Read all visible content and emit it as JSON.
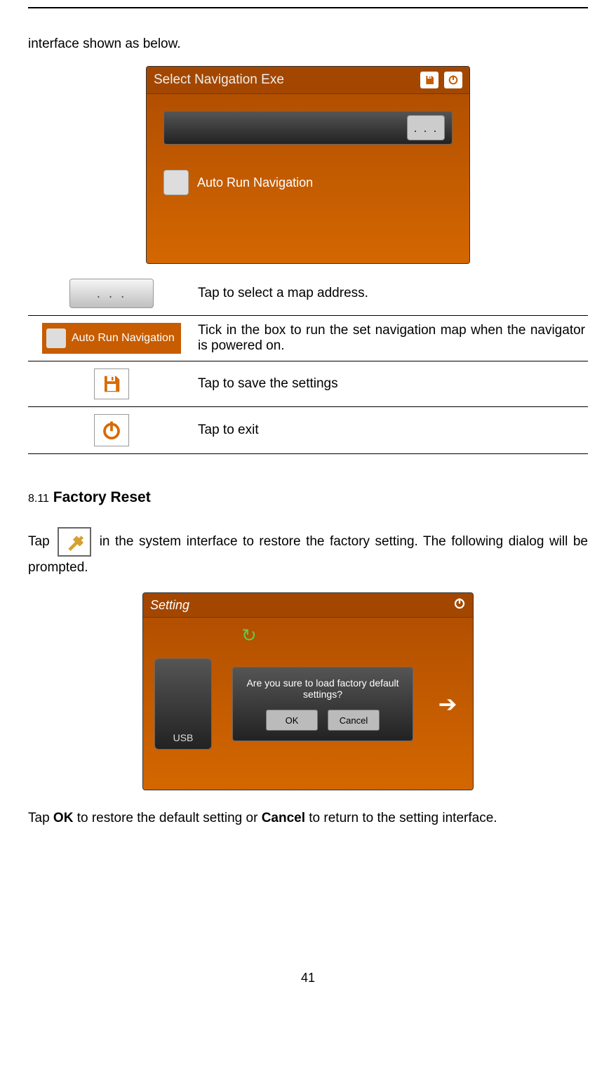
{
  "intro": "interface shown as below.",
  "screenshot1": {
    "title": "Select Navigation Exe",
    "path_btn": ". . .",
    "checkbox_label": "Auto Run Navigation"
  },
  "legend": [
    {
      "icon": "dots",
      "dots_label": ". . .",
      "desc": "Tap to select a map address."
    },
    {
      "icon": "autorun",
      "autorun_label": "Auto Run Navigation",
      "desc": "Tick in the box to run the set navigation map when the navigator is powered on."
    },
    {
      "icon": "save",
      "desc": "Tap to save the settings"
    },
    {
      "icon": "power",
      "desc": "Tap to exit"
    }
  ],
  "section": {
    "num": "8.11",
    "title": "Factory Reset"
  },
  "paragraph1_a": "Tap ",
  "paragraph1_b": " in the system interface to restore the factory setting. The following dialog will be prompted.",
  "screenshot2": {
    "title": "Setting",
    "usb_label": "USB",
    "dialog_text": "Are you sure to load factory default settings?",
    "ok": "OK",
    "cancel": "Cancel"
  },
  "paragraph2_a": "Tap ",
  "paragraph2_ok": "OK",
  "paragraph2_b": " to restore the default setting or ",
  "paragraph2_cancel": "Cancel",
  "paragraph2_c": " to return to the setting interface.",
  "page_number": "41"
}
